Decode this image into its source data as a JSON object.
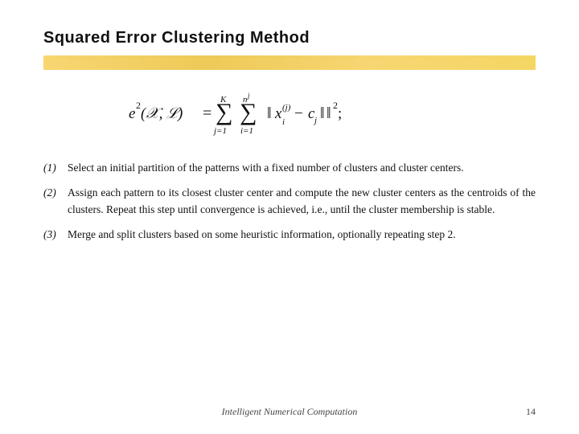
{
  "slide": {
    "title": "Squared  Error  Clustering  Method",
    "footer": {
      "label": "Intelligent Numerical Computation",
      "page": "14"
    },
    "list_items": [
      {
        "num": "(1)",
        "text": "Select an initial partition of the patterns with a fixed number of clusters and cluster centers."
      },
      {
        "num": "(2)",
        "text": "Assign each pattern to its closest cluster center and compute the new cluster centers as the centroids of the clusters. Repeat this step until convergence is achieved, i.e., until the cluster membership is stable."
      },
      {
        "num": "(3)",
        "text": "Merge and split clusters based on some heuristic information, optionally repeating step 2."
      }
    ]
  }
}
